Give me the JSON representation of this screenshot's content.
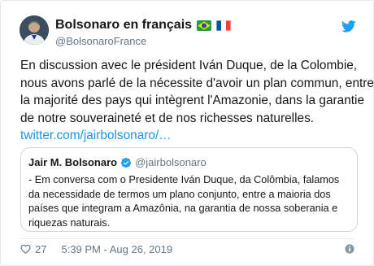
{
  "author": {
    "display_name": "Bolsonaro en français",
    "handle": "@BolsonaroFrance",
    "flags": [
      "brazil-flag",
      "france-flag"
    ]
  },
  "tweet": {
    "lines": [
      "En discussion avec le président Iván Duque, de la Colombie,",
      "nous avons parlé de la nécessite d'avoir un plan commun, entre",
      "la majorité des pays qui intègrent l'Amazonie, dans la garantie",
      "de notre souveraineté et de nos richesses naturelles."
    ],
    "link": "twitter.com/jairbolsonaro/…"
  },
  "quoted": {
    "name": "Jair M. Bolsonaro",
    "handle": "@jairbolsonaro",
    "lines": [
      "- Em conversa com o Presidente Iván Duque, da Colômbia, falamos",
      "da necessidade de termos um plano conjunto, entre a maioria dos",
      "países que integram a Amazônia, na garantia de nossa soberania e",
      "riquezas naturais."
    ]
  },
  "footer": {
    "likes": "27",
    "timestamp": "5:39 PM - Aug 26, 2019"
  },
  "colors": {
    "link": "#1b95e0",
    "verified": "#1da1f2",
    "brand": "#1da1f2",
    "secondary_text": "#657786"
  },
  "icons": {
    "bird": "twitter-bird-icon",
    "verified": "verified-badge-icon",
    "like": "heart-icon",
    "info": "info-icon"
  }
}
